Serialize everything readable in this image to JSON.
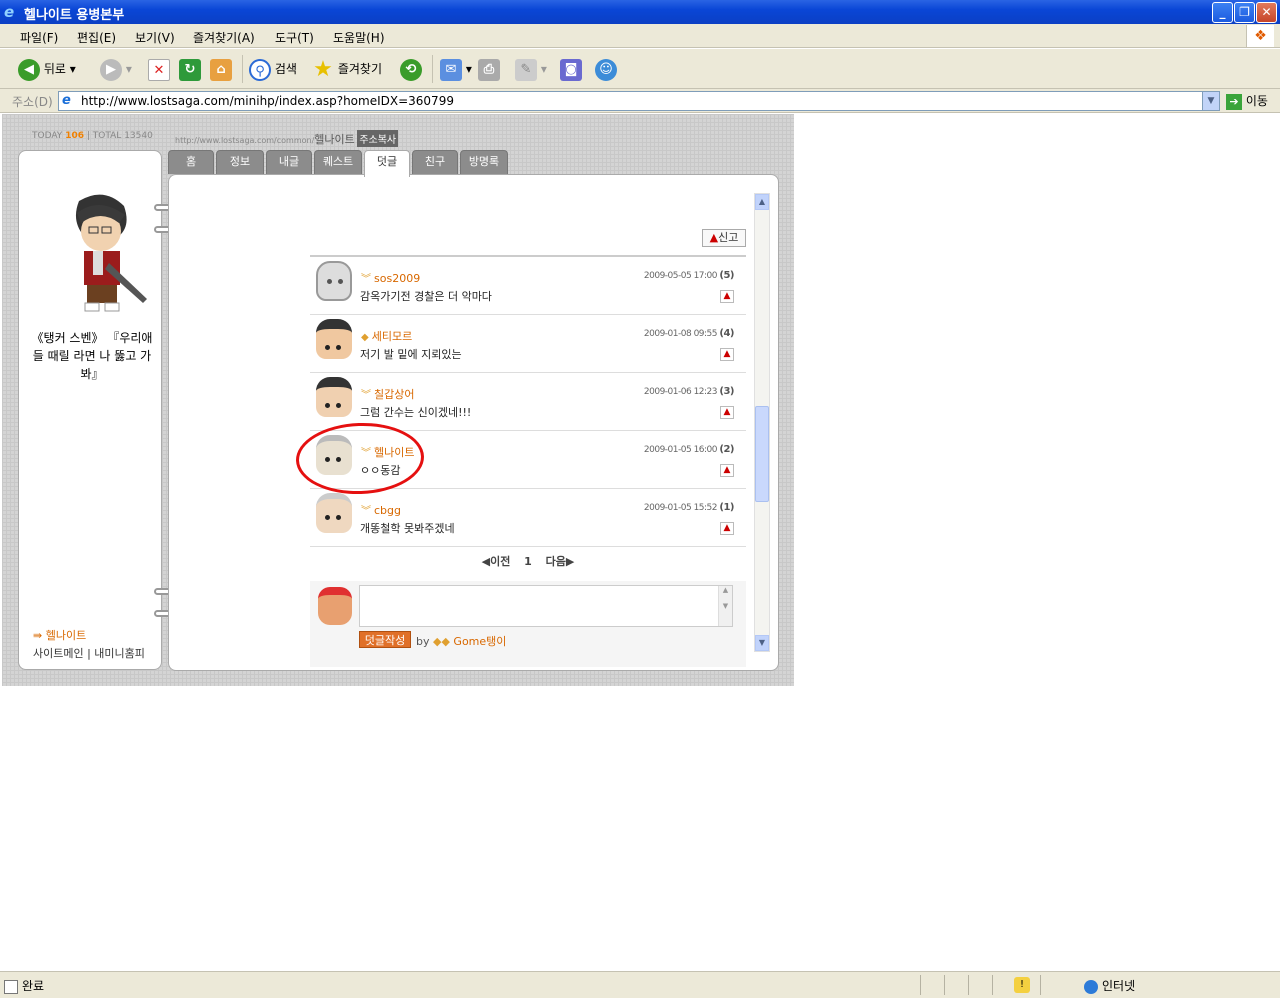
{
  "window": {
    "title": "헬나이트 용병본부"
  },
  "menu": [
    "파일(F)",
    "편집(E)",
    "보기(V)",
    "즐겨찾기(A)",
    "도구(T)",
    "도움말(H)"
  ],
  "toolbar": {
    "back": "뒤로",
    "search": "검색",
    "favorites": "즐겨찾기"
  },
  "address": {
    "label": "주소(D)",
    "url": "http://www.lostsaga.com/minihp/index.asp?homeIDX=360799",
    "go": "이동"
  },
  "header": {
    "today_label": "TODAY",
    "today": "106",
    "total_label": "| TOTAL",
    "total": "13540",
    "url_prefix": "http://www.lostsaga.com/common/",
    "name": "헬나이트",
    "copy": "주소복사"
  },
  "profile": {
    "text": "《탱커 스벤》 『우리애들 때릴 라면 나 뚫고 가봐』",
    "name": "헬나이트",
    "links": "사이트메인 | 내미니홈피"
  },
  "tabs": [
    "홈",
    "정보",
    "내글",
    "퀘스트",
    "덧글",
    "친구",
    "방명록"
  ],
  "active_tab": "덧글",
  "report_button": "신고",
  "comments": [
    {
      "name": "sos2009",
      "text": "감옥가기전 경찰은 더 악마다",
      "date": "2009-05-05 17:00",
      "num": "(5)"
    },
    {
      "name": "세티모르",
      "text": "저기 발 밑에 지뢰있는",
      "date": "2009-01-08 09:55",
      "num": "(4)"
    },
    {
      "name": "칠갑상어",
      "text": "그럼 간수는 신이겠네!!!",
      "date": "2009-01-06 12:23",
      "num": "(3)"
    },
    {
      "name": "헬나이트",
      "text": "ㅇㅇ동감",
      "date": "2009-01-05 16:00",
      "num": "(2)"
    },
    {
      "name": "cbgg",
      "text": "개똥철학 못봐주겠네",
      "date": "2009-01-05 15:52",
      "num": "(1)"
    }
  ],
  "pager": {
    "prev": "◀이전",
    "page": "1",
    "next": "다음▶"
  },
  "writer": {
    "button": "덧글작성",
    "by": "by",
    "name": "Gome탱이"
  },
  "status": {
    "text": "완료",
    "zone": "인터넷"
  }
}
